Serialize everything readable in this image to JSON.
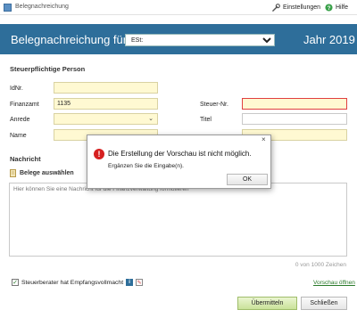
{
  "window": {
    "title": "Belegnachreichung",
    "menu": {
      "settings_label": "Einstellungen",
      "help_label": "Hilfe"
    }
  },
  "banner": {
    "title": "Belegnachreichung für",
    "tax_type_value": "ESt:",
    "year_label": "Jahr 2019"
  },
  "form": {
    "section_title": "Steuerpflichtige Person",
    "idnr_label": "IdNr.",
    "idnr_value": "",
    "finanzamt_label": "Finanzamt",
    "finanzamt_value": "1135",
    "steuernr_label": "Steuer-Nr.",
    "steuernr_value": "",
    "anrede_label": "Anrede",
    "anrede_value": "",
    "titel_label": "Titel",
    "titel_value": "",
    "name_label": "Name",
    "name_value": "",
    "vorname_value": ""
  },
  "message": {
    "section_title": "Nachricht",
    "attach_label": "Belege auswählen",
    "placeholder": "Hier können Sie eine Nachricht für die Finanzverwaltung formulieren",
    "counter": "0 von 1000 Zeichen"
  },
  "footer": {
    "checkbox_label": "Steuerberater hat Empfangsvollmacht",
    "checkbox_checked": true,
    "preview_link": "Vorschau öffnen",
    "submit_label": "Übermitteln",
    "close_label": "Schließen"
  },
  "dialog": {
    "close_glyph": "×",
    "headline": "Die Erstellung der Vorschau ist nicht möglich.",
    "subtext": "Ergänzen Sie die Eingabe(n).",
    "ok_label": "OK"
  },
  "colors": {
    "banner": "#2e6e9a",
    "required_field": "#fff9d2",
    "error_border": "#e04040",
    "error_icon": "#d62020",
    "submit_button": "#c9e29a"
  }
}
